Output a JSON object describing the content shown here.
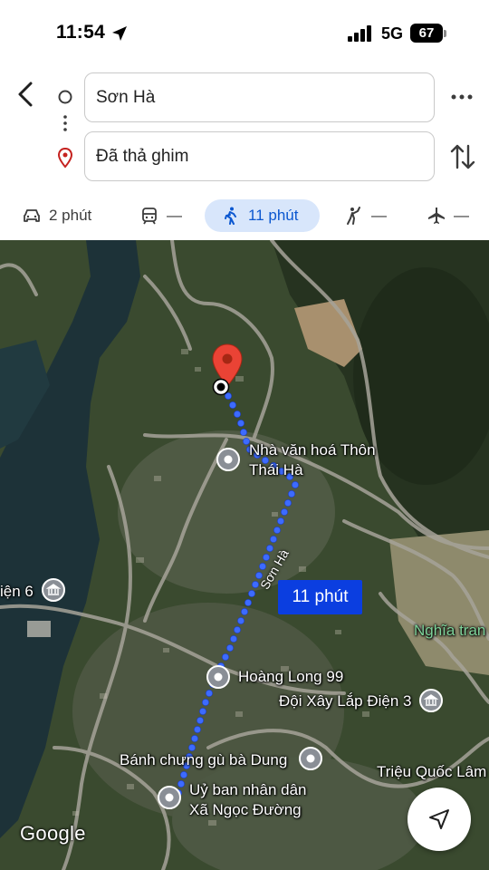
{
  "status_bar": {
    "time": "11:54",
    "network": "5G",
    "battery_level": "67"
  },
  "directions": {
    "origin": "Sơn Hà",
    "destination": "Đã thả ghim"
  },
  "modes": [
    {
      "icon": "car-icon",
      "label": "2 phút"
    },
    {
      "icon": "transit-icon",
      "label": "—"
    },
    {
      "icon": "walk-icon",
      "label": "11 phút",
      "selected": true
    },
    {
      "icon": "rideshare-icon",
      "label": "—"
    },
    {
      "icon": "flight-icon",
      "label": "—"
    }
  ],
  "map": {
    "route_badge": "11 phút",
    "street_label": "Sơn Hà",
    "attribution": "Google",
    "places": {
      "nha_van_hoa": "Nhà văn hoá Thôn\nThái Hà",
      "hoang_long": "Hoàng Long 99",
      "doi_xay_lap": "Đội Xây Lắp Điện 3",
      "banh_chung": "Bánh chưng gù bà Dung",
      "uy_ban": "Uỷ ban nhân dân\nXã Ngọc Đường",
      "trieu_quoc_lam": "Triệu Quốc Lâm",
      "nghia_trang": "Nghĩa tran",
      "dien_6": "iện 6"
    }
  },
  "colors": {
    "accent": "#0b57d0",
    "selected_mode_bg": "#d8e6fb",
    "route": "#2b5cf5",
    "pin": "#ea4335"
  }
}
